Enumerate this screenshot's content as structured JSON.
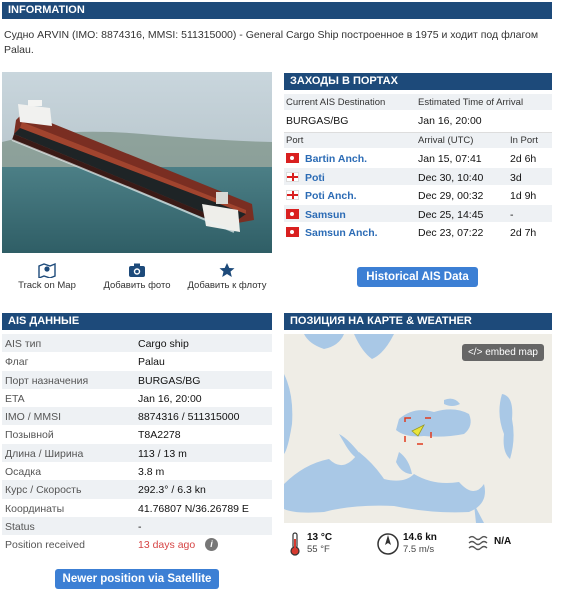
{
  "info": {
    "header": "INFORMATION",
    "text": "Судно ARVIN (IMO: 8874316, MMSI: 511315000) - General Cargo Ship построенное в 1975 и ходит под флагом Palau."
  },
  "actions": {
    "track": "Track on Map",
    "photo": "Добавить фото",
    "fleet": "Добавить к флоту"
  },
  "ports": {
    "header": "ЗАХОДЫ В ПОРТАХ",
    "dest_label": "Current AIS Destination",
    "eta_label": "Estimated Time of Arrival",
    "dest_value": "BURGAS/BG",
    "eta_value": "Jan 16, 20:00",
    "col_port": "Port",
    "col_arrival": "Arrival (UTC)",
    "col_inport": "In Port",
    "rows": [
      {
        "name": "Bartin Anch.",
        "arrival": "Jan 15, 07:41",
        "inport": "2d 6h",
        "flag": "TR"
      },
      {
        "name": "Poti",
        "arrival": "Dec 30, 10:40",
        "inport": "3d",
        "flag": "GE"
      },
      {
        "name": "Poti Anch.",
        "arrival": "Dec 29, 00:32",
        "inport": "1d 9h",
        "flag": "GE"
      },
      {
        "name": "Samsun",
        "arrival": "Dec 25, 14:45",
        "inport": "-",
        "flag": "TR"
      },
      {
        "name": "Samsun Anch.",
        "arrival": "Dec 23, 07:22",
        "inport": "2d 7h",
        "flag": "TR"
      }
    ],
    "button": "Historical AIS Data"
  },
  "ais": {
    "header": "AIS ДАННЫЕ",
    "rows": [
      {
        "k": "AIS тип",
        "v": "Cargo ship"
      },
      {
        "k": "Флаг",
        "v": "Palau"
      },
      {
        "k": "Порт назначения",
        "v": "BURGAS/BG"
      },
      {
        "k": "ETA",
        "v": "Jan 16, 20:00"
      },
      {
        "k": "IMO / MMSI",
        "v": "8874316 / 511315000"
      },
      {
        "k": "Позывной",
        "v": "T8A2278"
      },
      {
        "k": "Длина / Ширина",
        "v": "113 / 13 m"
      },
      {
        "k": "Осадка",
        "v": "3.8 m"
      },
      {
        "k": "Курс / Скорость",
        "v": "292.3° / 6.3 kn"
      },
      {
        "k": "Координаты",
        "v": "41.76807 N/36.26789 E"
      },
      {
        "k": "Status",
        "v": "-"
      },
      {
        "k": "Position received",
        "v": "13 days ago"
      }
    ],
    "button": "Newer position via Satellite"
  },
  "map": {
    "header": "ПОЗИЦИЯ НА КАРТЕ & WEATHER",
    "embed": "</> embed map"
  },
  "weather": {
    "temp_c": "13 °C",
    "temp_f": "55 °F",
    "wind_kn": "14.6 kn",
    "wind_ms": "7.5 m/s",
    "waves": "N/A"
  },
  "colors": {
    "header": "#1d4a7a",
    "button": "#3c7fd4",
    "link": "#2b6bb5",
    "sea": "#a9c8e6"
  }
}
